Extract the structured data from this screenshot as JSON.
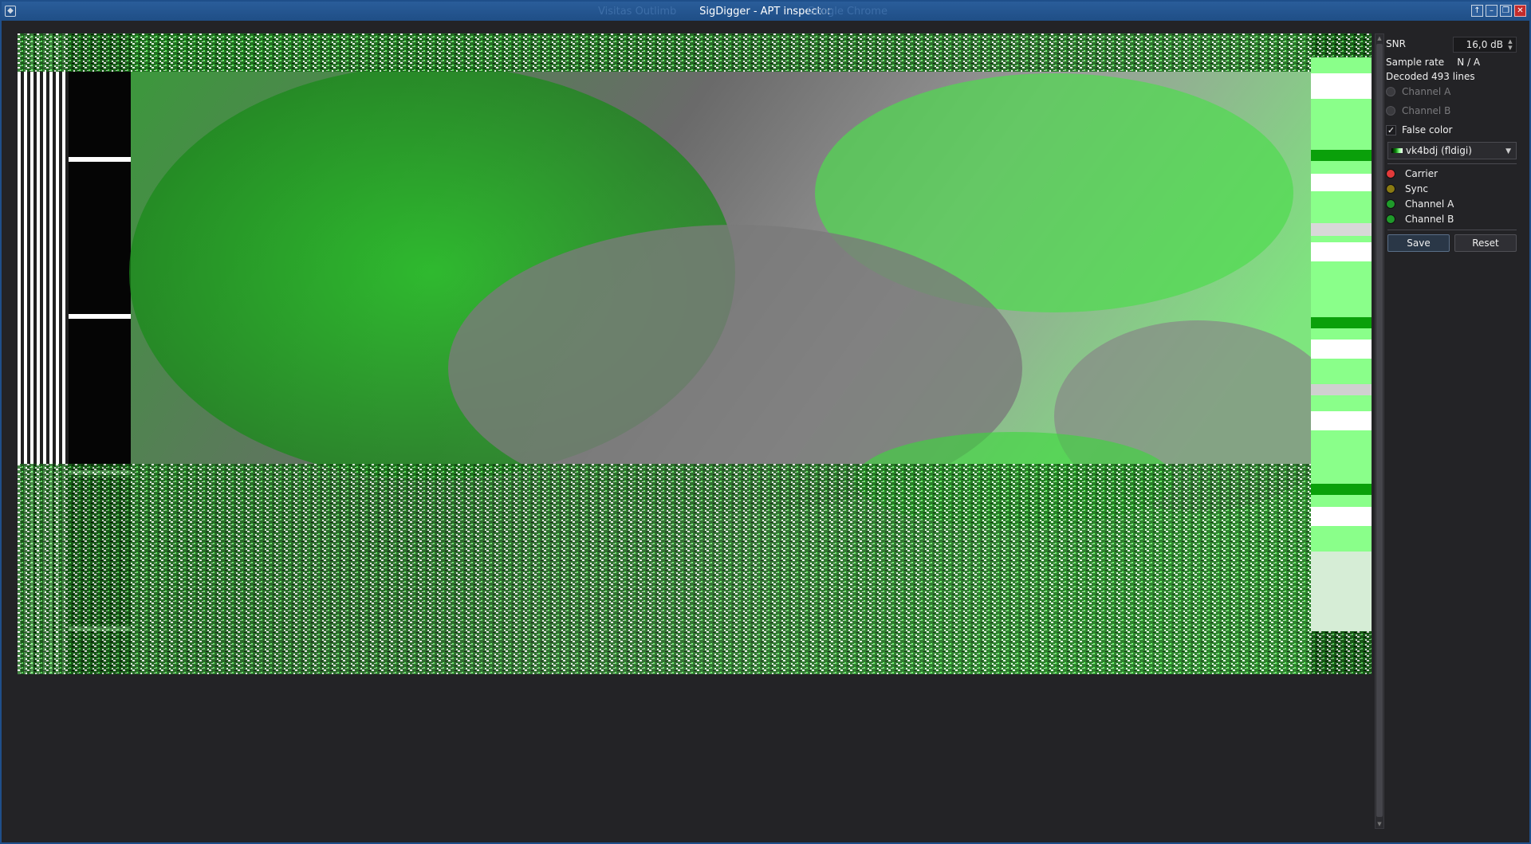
{
  "window": {
    "title": "SigDigger - APT inspector",
    "ghost_left": "Visitas Outlimb",
    "ghost_right": "Google Chrome"
  },
  "controls": {
    "snr_label": "SNR",
    "snr_value": "16,0 dB",
    "sample_rate_label": "Sample rate",
    "sample_rate_value": "N / A",
    "decoded": "Decoded 493 lines",
    "channel_a": "Channel A",
    "channel_b": "Channel B",
    "false_color": "False color",
    "false_color_checked": true,
    "palette": "vk4bdj (fldigi)",
    "save": "Save",
    "reset": "Reset"
  },
  "indicators": [
    {
      "label": "Carrier",
      "color": "#e23a3a"
    },
    {
      "label": "Sync",
      "color": "#8a7a12"
    },
    {
      "label": "Channel A",
      "color": "#1f9a2a"
    },
    {
      "label": "Channel B",
      "color": "#1f9a2a"
    }
  ]
}
